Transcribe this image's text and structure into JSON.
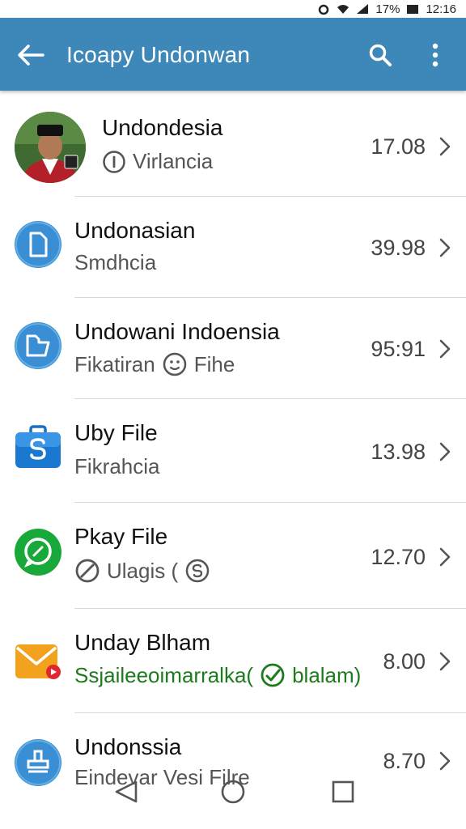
{
  "status": {
    "battery": "17%",
    "time": "12:16"
  },
  "app_bar": {
    "title": "Icoapy Undonwan",
    "accent": "#3d88b8"
  },
  "rows": [
    {
      "title": "Undondesia",
      "subtitle": "Virlancia",
      "value": "17.08",
      "sub_icon": "info-icon"
    },
    {
      "title": "Undonasian",
      "subtitle": "Smdhcia",
      "value": "39.98"
    },
    {
      "title": "Undowani Indoensia",
      "subtitle": "Fikatiran",
      "subtitle_extra": "Fihe",
      "value": "95:91",
      "sub_icon": "smiley-icon"
    },
    {
      "title": "Uby File",
      "subtitle": "Fikrahcia",
      "value": "13.98"
    },
    {
      "title": "Pkay File",
      "subtitle": "Ulagis (",
      "value": "12.70",
      "sub_icon": "block-icon",
      "sub_icon2": "dollar-icon"
    },
    {
      "title": "Unday Blham",
      "subtitle": "Ssjaileeoimarralka(",
      "subtitle_extra": "blalam)",
      "value": "8.00",
      "sub_icon": "check-circle-icon"
    },
    {
      "title": "Undonssia",
      "subtitle": "Eindevar Vesi Filre",
      "value": "8.70"
    }
  ]
}
